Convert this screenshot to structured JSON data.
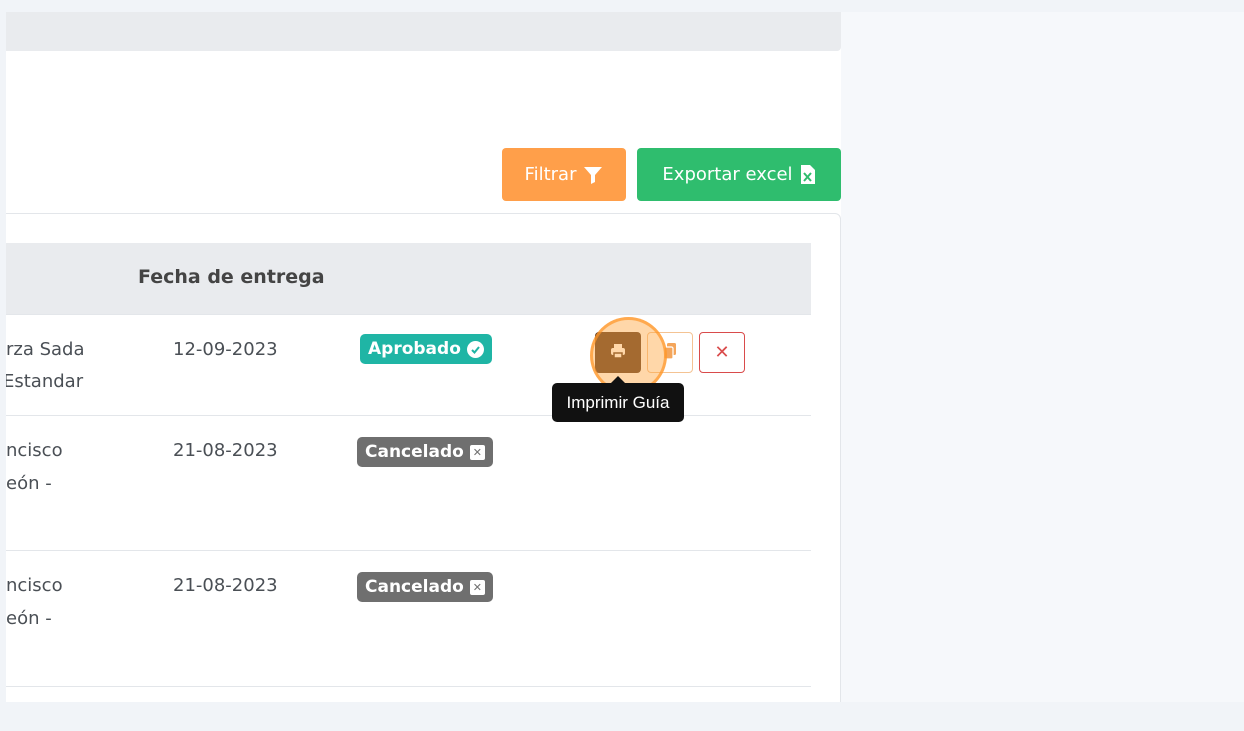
{
  "toolbar": {
    "filter_label": "Filtrar",
    "export_label": "Exportar excel"
  },
  "table": {
    "columns": {
      "fecha_entrega": "Fecha de entrega"
    },
    "rows": [
      {
        "client_line1": "rza Sada",
        "client_line2": "Estandar",
        "date": "12-09-2023",
        "status": "Aprobado"
      },
      {
        "client_line1": "ncisco",
        "client_line2": "eón -",
        "date": "21-08-2023",
        "status": "Cancelado"
      },
      {
        "client_line1": "ncisco",
        "client_line2": "eón -",
        "date": "21-08-2023",
        "status": "Cancelado"
      }
    ]
  },
  "tooltip": {
    "text": "Imprimir Guía"
  },
  "colors": {
    "filter": "#ff9f4a",
    "export": "#2fbd6e",
    "approved": "#1fb5a5",
    "cancelled": "#6f6f6f",
    "print_button": "#5a3a24",
    "delete_border": "#d94b4b"
  },
  "icons": {
    "filter": "filter-icon",
    "export": "excel-file-icon",
    "approved": "check-circle-icon",
    "cancelled": "close-square-icon",
    "print": "printer-icon",
    "copy": "copy-icon",
    "delete": "close-icon"
  }
}
